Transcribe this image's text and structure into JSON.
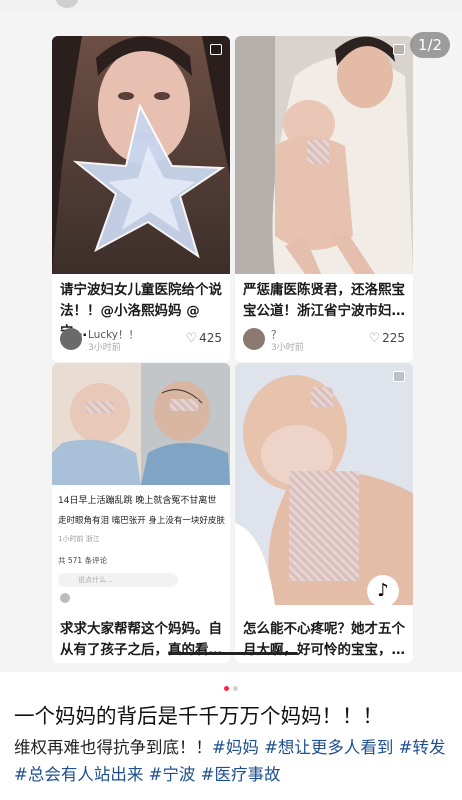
{
  "carousel": {
    "page_counter": "1/2",
    "active_index": 0,
    "total": 2
  },
  "cards": [
    {
      "title": "请宁波妇女儿童医院给个说法！！@小洛熙妈妈 @宁…",
      "username": "Lucky！！",
      "time": "3小时前",
      "likes": "425"
    },
    {
      "title": "严惩庸医陈贤君，还洛熙宝宝公道！浙江省宁波市妇…",
      "username": "？",
      "time": "3小时前",
      "likes": "225"
    },
    {
      "title": "求求大家帮帮这个妈妈。自从有了孩子之后，真的看…",
      "screenshot_caption_1": "14日早上活蹦乱跳 晚上就含冤不甘离世",
      "screenshot_caption_2": "走时眼角有泪 嘴巴张开 身上没有一块好皮肤",
      "screenshot_meta": "1小时前 浙江",
      "screenshot_comments": "共 571 条评论",
      "screenshot_input": "说点什么..."
    },
    {
      "title": "怎么能不心疼呢？她才五个月大啊，好可怜的宝宝，…"
    }
  ],
  "post": {
    "title": "一个妈妈的背后是千千万万个妈妈！！！",
    "body_text": "维权再难也得抗争到底！！",
    "tags": [
      "#妈妈",
      "#想让更多人看到",
      "#转发",
      "#总会有人站出来",
      "#宁波",
      "#医疗事故"
    ]
  },
  "colors": {
    "accent_dot": "#ff2442",
    "tag": "#1d4f91"
  },
  "icons": {
    "likes": "heart-outline-icon",
    "video": "video-badge-icon",
    "tiktok": "tiktok-logo-icon"
  }
}
